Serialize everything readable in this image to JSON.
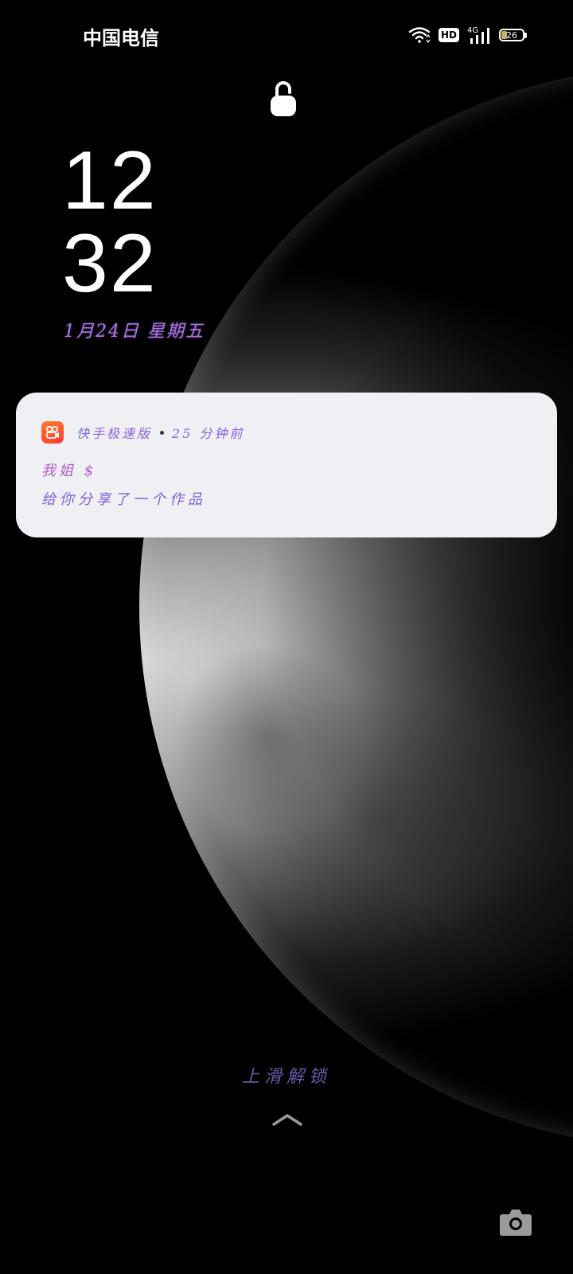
{
  "status_bar": {
    "carrier": "中国电信",
    "hd_label": "HD",
    "network": "4G",
    "battery_level": "26",
    "icons": [
      "wifi-icon",
      "hd-icon",
      "signal-4g-icon",
      "battery-icon"
    ]
  },
  "lock": {
    "icon": "unlocked-padlock-icon"
  },
  "clock": {
    "hours": "12",
    "minutes": "32",
    "date": "1月24日 星期五"
  },
  "notification": {
    "app_name": "快手极速版",
    "time_ago": "25 分钟前",
    "title": "我姐 $",
    "body": "给你分享了一个作品",
    "app_icon_colors": [
      "#ff7a2e",
      "#ff3a30"
    ]
  },
  "unlock": {
    "hint": "上滑解锁",
    "icon": "chevron-up-icon"
  },
  "camera": {
    "icon": "camera-icon"
  },
  "colors": {
    "card_background": "#eff0f4",
    "background": "#000000"
  }
}
